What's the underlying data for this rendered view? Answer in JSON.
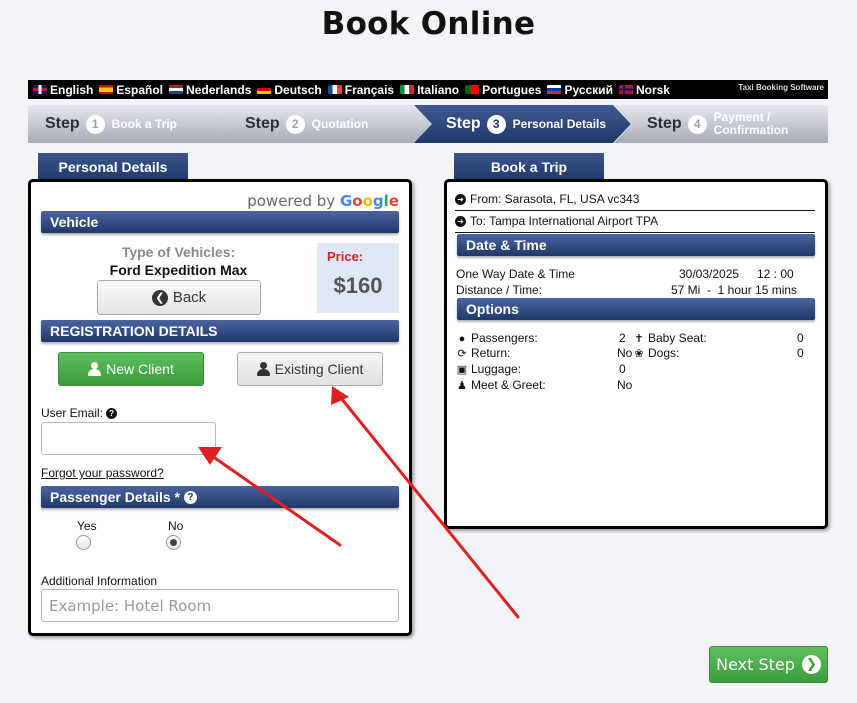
{
  "page": {
    "title": "Book Online"
  },
  "languages": [
    {
      "label": "English",
      "flag": "uk"
    },
    {
      "label": "Español",
      "flag": "es"
    },
    {
      "label": "Nederlands",
      "flag": "nl"
    },
    {
      "label": "Deutsch",
      "flag": "de"
    },
    {
      "label": "Français",
      "flag": "fr"
    },
    {
      "label": "Italiano",
      "flag": "it"
    },
    {
      "label": "Portugues",
      "flag": "pt"
    },
    {
      "label": "Русский",
      "flag": "ru"
    },
    {
      "label": "Norsk",
      "flag": "no"
    }
  ],
  "brand_text": "Taxi Booking Software",
  "steps": [
    {
      "word": "Step",
      "number": "1",
      "label": "Book a Trip",
      "state": "inactive"
    },
    {
      "word": "Step",
      "number": "2",
      "label": "Quotation",
      "state": "inactive"
    },
    {
      "word": "Step",
      "number": "3",
      "label": "Personal Details",
      "state": "active"
    },
    {
      "word": "Step",
      "number": "4",
      "label": "Payment / Confirmation",
      "state": "inactive"
    }
  ],
  "left_panel": {
    "tab_title": "Personal Details",
    "powered_by": "powered by",
    "google": [
      "G",
      "o",
      "o",
      "g",
      "l",
      "e"
    ],
    "vehicle_section": "Vehicle",
    "vehicle_type_label": "Type of Vehicles:",
    "vehicle_type_value": "Ford Expedition Max",
    "back_label": "Back",
    "price_label": "Price:",
    "price_value": "$160",
    "registration_section": "REGISTRATION DETAILS",
    "new_client_label": "New Client",
    "existing_client_label": "Existing Client",
    "user_email_label": "User Email:",
    "user_email_value": "",
    "forgot_password": "Forgot your password?",
    "passenger_section": "Passenger Details *",
    "radio_yes": "Yes",
    "radio_no": "No",
    "radio_selected": "No",
    "additional_info_label": "Additional Information",
    "additional_info_placeholder": "Example: Hotel Room"
  },
  "right_panel": {
    "tab_title": "Book a Trip",
    "from": "From: Sarasota, FL, USA vc343",
    "to": "To: Tampa International Airport TPA",
    "date_section": "Date & Time",
    "one_way_label": "One Way Date & Time",
    "one_way_date": "30/03/2025",
    "one_way_time": "12 : 00",
    "distance_label": "Distance / Time:",
    "distance_value": "57 Mi  -  1 hour 15 mins",
    "options_section": "Options",
    "passengers_label": "Passengers:",
    "passengers_value": "2",
    "baby_seat_label": "Baby Seat:",
    "baby_seat_value": "0",
    "return_label": "Return:",
    "return_value": "No",
    "dogs_label": "Dogs:",
    "dogs_value": "0",
    "luggage_label": "Luggage:",
    "luggage_value": "0",
    "meet_label": "Meet & Greet:",
    "meet_value": "No"
  },
  "next_step_label": "Next Step",
  "colors": {
    "nav_blue": "#203868",
    "green": "#3c9a3c",
    "annotation_red": "#e02020"
  }
}
